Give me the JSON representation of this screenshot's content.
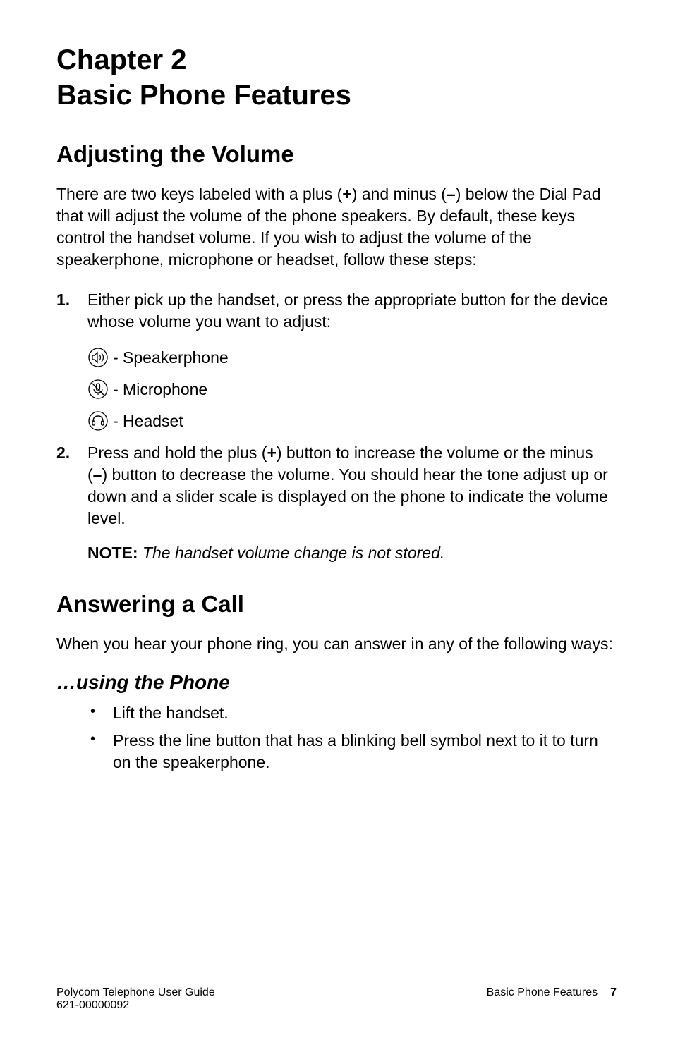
{
  "chapter": {
    "line1": "Chapter 2",
    "line2": "Basic Phone Features"
  },
  "section1": {
    "title": "Adjusting the Volume",
    "intro_pre": "There are two keys labeled with a plus (",
    "intro_plus": "+",
    "intro_mid": ") and minus (",
    "intro_minus": "–",
    "intro_post": ") below the Dial Pad that will adjust the volume of the phone speakers. By default, these keys control the handset volume. If you wish to adjust the volume of the speakerphone, microphone or headset, follow these steps:",
    "step1": {
      "num": "1.",
      "text": "Either pick up the handset, or press the appropriate button for the device whose volume you want to adjust:"
    },
    "icons": {
      "speakerphone": " - Speakerphone",
      "microphone": " - Microphone",
      "headset": " - Headset"
    },
    "step2": {
      "num": "2.",
      "pre": "Press and hold the plus (",
      "plus": "+",
      "mid": ") button to increase the volume or the minus (",
      "minus": "–",
      "post": ") button to decrease the volume.  You should hear the tone adjust up or down and a slider scale is displayed on the phone to indicate the volume level."
    },
    "note_label": "NOTE: ",
    "note_text": "The handset volume change is not stored."
  },
  "section2": {
    "title": "Answering a Call",
    "intro": "When you hear your phone ring, you can answer in any of the following ways:",
    "sub": "…using the Phone",
    "bullet1": "Lift the handset.",
    "bullet2": "Press the line button that has a blinking bell symbol next to it to turn on the speakerphone."
  },
  "footer": {
    "left_line1": "Polycom Telephone User Guide",
    "left_line2": "621-00000092",
    "right_label": "Basic Phone Features",
    "page": "7"
  }
}
